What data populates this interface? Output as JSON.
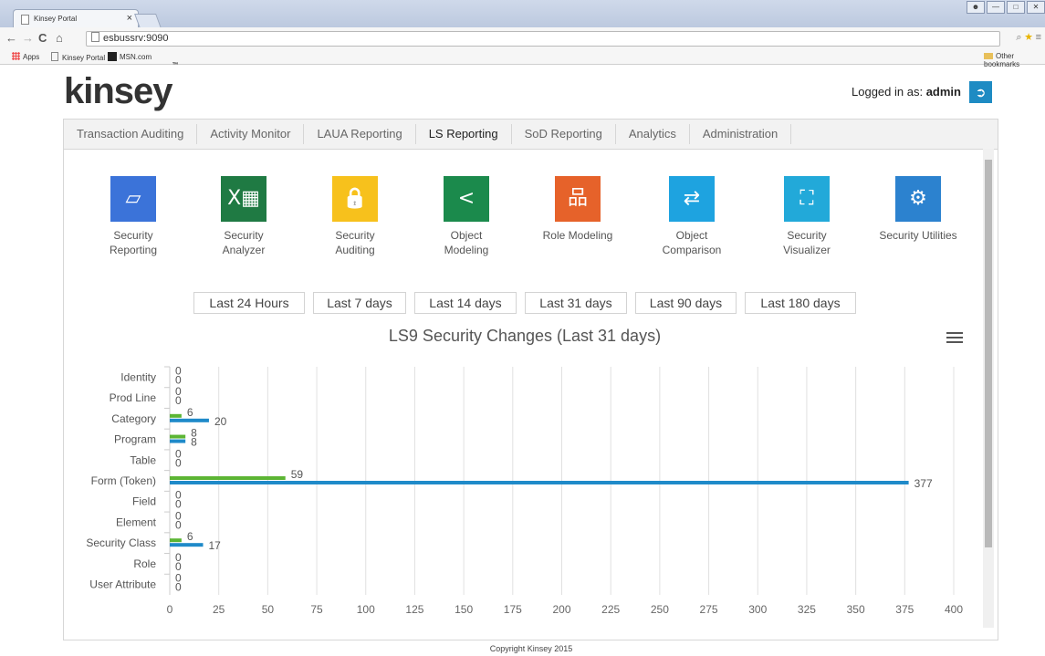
{
  "browser": {
    "tab_title": "Kinsey Portal",
    "tab_close": "×",
    "url": "esbussrv:9090",
    "bookmarks": [
      "Apps",
      "Kinsey Portal",
      "MSN.com"
    ],
    "other_bookmarks": "Other bookmarks"
  },
  "header": {
    "logo": "kinsey",
    "logo_tm": "™",
    "login_label": "Logged in as:",
    "login_user": "admin"
  },
  "menu": [
    "Transaction Auditing",
    "Activity Monitor",
    "LAUA Reporting",
    "LS Reporting",
    "SoD Reporting",
    "Analytics",
    "Administration"
  ],
  "menu_active": "LS Reporting",
  "modules": [
    {
      "line1": "Security",
      "line2": "Reporting",
      "icon": "monitor-icon",
      "color": "#3b73d9"
    },
    {
      "line1": "Security",
      "line2": "Analyzer",
      "icon": "excel-icon",
      "color": "#1f7a43"
    },
    {
      "line1": "Security",
      "line2": "Auditing",
      "icon": "lock-icon",
      "color": "#f7c11c"
    },
    {
      "line1": "Object",
      "line2": "Modeling",
      "icon": "share-icon",
      "color": "#1b8a4c"
    },
    {
      "line1": "Role Modeling",
      "line2": "",
      "icon": "hierarchy-icon",
      "color": "#e6622a"
    },
    {
      "line1": "Object",
      "line2": "Comparison",
      "icon": "swap-icon",
      "color": "#1ea3e0"
    },
    {
      "line1": "Security",
      "line2": "Visualizer",
      "icon": "network-icon",
      "color": "#22a9d9"
    },
    {
      "line1": "Security Utilities",
      "line2": "",
      "icon": "gears-icon",
      "color": "#2c82cf"
    }
  ],
  "ranges": [
    "Last 24 Hours",
    "Last 7 days",
    "Last 14 days",
    "Last 31 days",
    "Last 90 days",
    "Last 180 days"
  ],
  "copyright": "Copyright Kinsey 2015",
  "colors": {
    "green": "#5cb534",
    "blue": "#1f8ac9",
    "accent": "#1e8bc3"
  },
  "chart_data": {
    "type": "bar",
    "orientation": "horizontal",
    "title": "LS9 Security Changes (Last 31 days)",
    "categories": [
      "Identity",
      "Prod Line",
      "Category",
      "Program",
      "Table",
      "Form (Token)",
      "Field",
      "Element",
      "Security Class",
      "Role",
      "User Attribute"
    ],
    "series": [
      {
        "values": [
          0,
          0,
          6,
          8,
          0,
          59,
          0,
          0,
          6,
          0,
          0
        ]
      },
      {
        "values": [
          0,
          0,
          20,
          8,
          0,
          377,
          0,
          0,
          17,
          0,
          0
        ]
      }
    ],
    "xlim": [
      0,
      400
    ],
    "xticks": [
      0,
      25,
      50,
      75,
      100,
      125,
      150,
      175,
      200,
      225,
      250,
      275,
      300,
      325,
      350,
      375,
      400
    ],
    "grid": true,
    "legend": "none"
  }
}
